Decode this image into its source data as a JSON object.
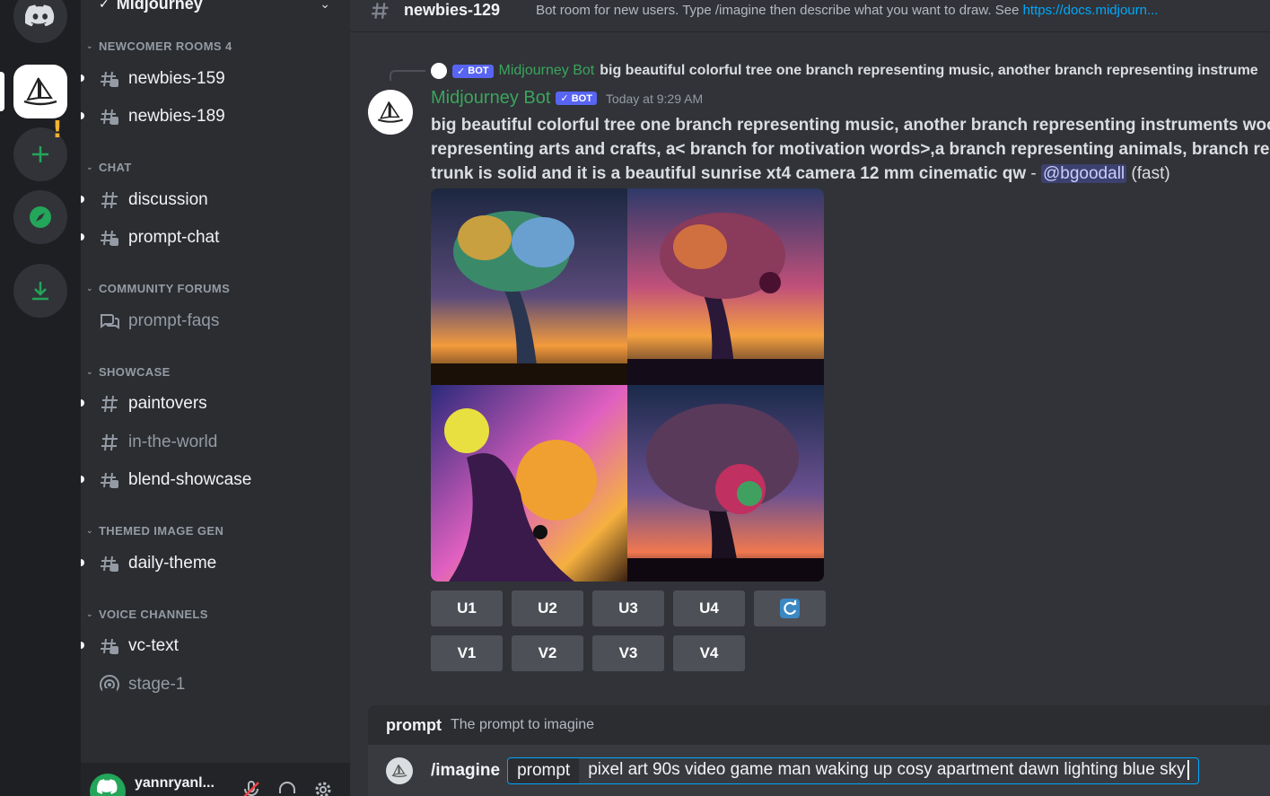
{
  "server": {
    "name": "Midjourney"
  },
  "categories": {
    "newcomer": "NEWCOMER ROOMS 4",
    "chat": "CHAT",
    "forums": "COMMUNITY FORUMS",
    "showcase": "SHOWCASE",
    "themed": "THEMED IMAGE GEN",
    "voice": "VOICE CHANNELS"
  },
  "channels": {
    "newbies159": "newbies-159",
    "newbies189": "newbies-189",
    "discussion": "discussion",
    "prompt_chat": "prompt-chat",
    "prompt_faqs": "prompt-faqs",
    "paintovers": "paintovers",
    "in_the_world": "in-the-world",
    "blend_showcase": "blend-showcase",
    "daily_theme": "daily-theme",
    "vc_text": "vc-text",
    "stage1": "stage-1"
  },
  "user": {
    "name": "yannryanl..."
  },
  "header": {
    "channel": "newbies-129",
    "topic": "Bot room for new users. Type /imagine then describe what you want to draw. See ",
    "topic_link": "https://docs.midjourn..."
  },
  "reply": {
    "badge": "BOT",
    "author": "Midjourney Bot",
    "text": "big beautiful colorful tree one branch representing music, another branch representing instrume"
  },
  "message": {
    "author": "Midjourney Bot",
    "badge": "BOT",
    "timestamp": "Today at 9:29 AM",
    "line1": "big beautiful colorful tree one branch representing music, another branch representing instruments wood",
    "line2": "representing arts and crafts, a< branch for motivation words>,a branch representing animals, branch repre",
    "line3": "trunk is solid and it is a beautiful sunrise xt4 camera 12 mm cinematic qw",
    "dash": " - ",
    "mention": "@bgoodall",
    "mode": " (fast)"
  },
  "buttons": {
    "u1": "U1",
    "u2": "U2",
    "u3": "U3",
    "u4": "U4",
    "v1": "V1",
    "v2": "V2",
    "v3": "V3",
    "v4": "V4"
  },
  "hint": {
    "key": "prompt",
    "value": "The prompt to imagine"
  },
  "composer": {
    "command": "/imagine",
    "option": "prompt",
    "value": "pixel art 90s video game man waking up cosy apartment dawn lighting blue sky"
  },
  "colors": {
    "accent": "#5865f2",
    "bot_name": "#3ba55c",
    "link": "#00a8fc"
  }
}
